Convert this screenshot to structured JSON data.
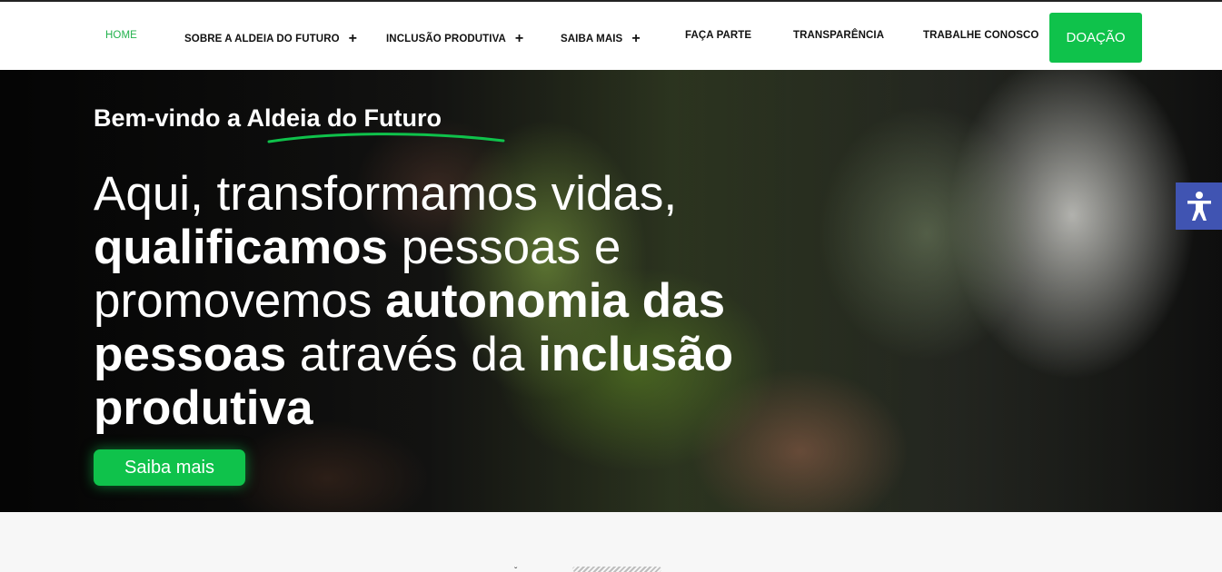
{
  "nav": {
    "items": [
      {
        "label": "HOME",
        "active": true,
        "has_submenu": false
      },
      {
        "label": "SOBRE A ALDEIA DO FUTURO",
        "active": false,
        "has_submenu": true
      },
      {
        "label": "INCLUSÃO PRODUTIVA",
        "active": false,
        "has_submenu": true
      },
      {
        "label": "SAIBA MAIS",
        "active": false,
        "has_submenu": true
      },
      {
        "label": "FAÇA PARTE",
        "active": false,
        "has_submenu": false
      },
      {
        "label": "TRANSPARÊNCIA",
        "active": false,
        "has_submenu": false
      },
      {
        "label": "TRABALHE CONOSCO",
        "active": false,
        "has_submenu": false
      }
    ],
    "submenu_glyph": "+",
    "donate_label": "DOAÇÃO"
  },
  "hero": {
    "welcome_prefix": "Bem-vindo a ",
    "welcome_highlight": "Aldeia do Futuro",
    "headline": {
      "p1": "Aqui, transformamos vidas, ",
      "b1": "qualificamos",
      "p2": " pessoas e promovemos ",
      "b2": "autonomia das pessoas",
      "p3": " através da ",
      "b3": "inclusão produtiva"
    },
    "cta_label": "Saiba mais"
  },
  "accessibility": {
    "icon": "accessibility-person-icon"
  },
  "colors": {
    "accent_green": "#0fc24b",
    "active_nav": "#22b24c",
    "accessibility_blue": "#4054b2",
    "nav_bg": "#ffffff"
  }
}
